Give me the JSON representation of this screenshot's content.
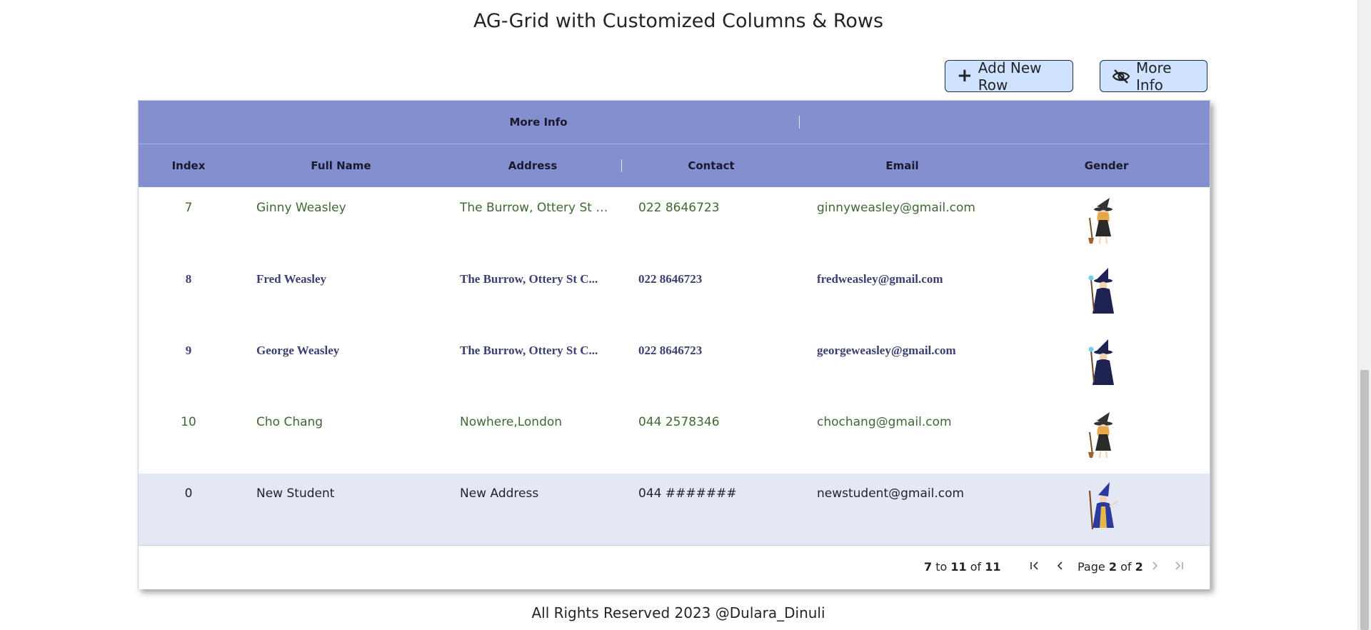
{
  "page": {
    "title": "AG-Grid with Customized Columns & Rows",
    "credits": "All Rights Reserved 2023 @Dulara_Dinuli"
  },
  "toolbar": {
    "add_label": "Add New Row",
    "add_icon": "plus-icon",
    "more_label": "More Info",
    "more_icon": "eye-slash-icon"
  },
  "grid": {
    "group_header": "More Info",
    "columns": [
      "Index",
      "Full Name",
      "Address",
      "Contact",
      "Email",
      "Gender"
    ],
    "rows": [
      {
        "index": "7",
        "name": "Ginny Weasley",
        "address": "The Burrow, Ottery St C...",
        "contact": "022 8646723",
        "email": "ginnyweasley@gmail.com",
        "avatar": "witch-avatar-icon",
        "style": "green"
      },
      {
        "index": "8",
        "name": "Fred Weasley",
        "address": "The Burrow, Ottery St C...",
        "contact": "022 8646723",
        "email": "fredweasley@gmail.com",
        "avatar": "wizard-avatar-icon",
        "style": "navy"
      },
      {
        "index": "9",
        "name": "George Weasley",
        "address": "The Burrow, Ottery St C...",
        "contact": "022 8646723",
        "email": "georgeweasley@gmail.com",
        "avatar": "wizard-avatar-icon",
        "style": "navy"
      },
      {
        "index": "10",
        "name": "Cho Chang",
        "address": "Nowhere,London",
        "contact": "044 2578346",
        "email": "chochang@gmail.com",
        "avatar": "witch-avatar-icon",
        "style": "green"
      },
      {
        "index": "0",
        "name": "New Student",
        "address": "New Address",
        "contact": "044 #######",
        "email": "newstudent@gmail.com",
        "avatar": "old-wizard-avatar-icon",
        "style": "plain"
      }
    ],
    "paging": {
      "from": "7",
      "to_word": "to",
      "to": "11",
      "of_word": "of",
      "total": "11",
      "page_word": "Page",
      "page": "2",
      "page_of_word": "of",
      "pages": "2"
    },
    "colors": {
      "header_bg": "#838fcf",
      "row_text_green": "#3d6a32",
      "row_text_navy": "#3b3f72",
      "selected_row_bg": "#e4e8f4",
      "button_bg": "#cfe2ff"
    }
  }
}
